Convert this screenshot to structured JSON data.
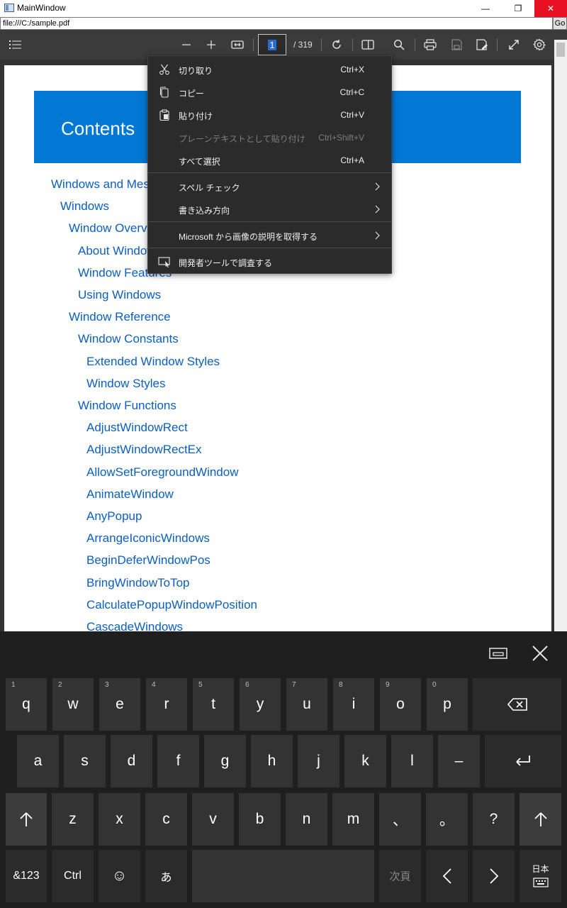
{
  "window": {
    "title": "MainWindow",
    "min_glyph": "—",
    "max_glyph": "❐",
    "close_glyph": "✕"
  },
  "address": {
    "url": "file:///C:/sample.pdf",
    "go_label": "Go"
  },
  "pdf_toolbar": {
    "page_current": "1",
    "page_total": "/ 319"
  },
  "document": {
    "contents_title": "Contents",
    "toc": [
      {
        "label": "Windows and Messages",
        "level": 0
      },
      {
        "label": "Windows",
        "level": 1
      },
      {
        "label": "Window Overview",
        "level": 2
      },
      {
        "label": "About Windows",
        "level": 3
      },
      {
        "label": "Window Features",
        "level": 3
      },
      {
        "label": "Using Windows",
        "level": 3
      },
      {
        "label": "Window Reference",
        "level": 2
      },
      {
        "label": "Window Constants",
        "level": 3
      },
      {
        "label": "Extended Window Styles",
        "level": 4
      },
      {
        "label": "Window Styles",
        "level": 4
      },
      {
        "label": "Window Functions",
        "level": 3
      },
      {
        "label": "AdjustWindowRect",
        "level": 4
      },
      {
        "label": "AdjustWindowRectEx",
        "level": 4
      },
      {
        "label": "AllowSetForegroundWindow",
        "level": 4
      },
      {
        "label": "AnimateWindow",
        "level": 4
      },
      {
        "label": "AnyPopup",
        "level": 4
      },
      {
        "label": "ArrangeIconicWindows",
        "level": 4
      },
      {
        "label": "BeginDeferWindowPos",
        "level": 4
      },
      {
        "label": "BringWindowToTop",
        "level": 4
      },
      {
        "label": "CalculatePopupWindowPosition",
        "level": 4
      },
      {
        "label": "CascadeWindows",
        "level": 4
      }
    ]
  },
  "context_menu": {
    "items": [
      {
        "label": "切り取り",
        "shortcut": "Ctrl+X",
        "icon": "scissors-icon",
        "disabled": false
      },
      {
        "label": "コピー",
        "shortcut": "Ctrl+C",
        "icon": "copy-icon",
        "disabled": false
      },
      {
        "label": "貼り付け",
        "shortcut": "Ctrl+V",
        "icon": "paste-icon",
        "disabled": false
      },
      {
        "label": "プレーンテキストとして貼り付け",
        "shortcut": "Ctrl+Shift+V",
        "icon": "",
        "disabled": true
      },
      {
        "label": "すべて選択",
        "shortcut": "Ctrl+A",
        "icon": "",
        "disabled": false
      },
      {
        "label": "スペル チェック",
        "shortcut": "",
        "icon": "",
        "disabled": false,
        "submenu": true
      },
      {
        "label": "書き込み方向",
        "shortcut": "",
        "icon": "",
        "disabled": false,
        "submenu": true
      },
      {
        "label": "Microsoft から画像の説明を取得する",
        "shortcut": "",
        "icon": "",
        "disabled": false,
        "submenu": true
      },
      {
        "label": "開発者ツールで調査する",
        "shortcut": "",
        "icon": "devtools-icon",
        "disabled": false
      }
    ]
  },
  "keyboard": {
    "row1": [
      {
        "num": "1",
        "label": "q"
      },
      {
        "num": "2",
        "label": "w"
      },
      {
        "num": "3",
        "label": "e"
      },
      {
        "num": "4",
        "label": "r"
      },
      {
        "num": "5",
        "label": "t"
      },
      {
        "num": "6",
        "label": "y"
      },
      {
        "num": "7",
        "label": "u"
      },
      {
        "num": "8",
        "label": "i"
      },
      {
        "num": "9",
        "label": "o"
      },
      {
        "num": "0",
        "label": "p"
      }
    ],
    "row2": [
      "a",
      "s",
      "d",
      "f",
      "g",
      "h",
      "j",
      "k",
      "l",
      "–"
    ],
    "row3": [
      "z",
      "x",
      "c",
      "v",
      "b",
      "n",
      "m",
      "、",
      "。",
      "?"
    ],
    "row4": {
      "symbols": "&123",
      "ctrl": "Ctrl",
      "emoji": "☺",
      "kana": "あ",
      "next_page": "次頁",
      "lang": "日本"
    }
  }
}
